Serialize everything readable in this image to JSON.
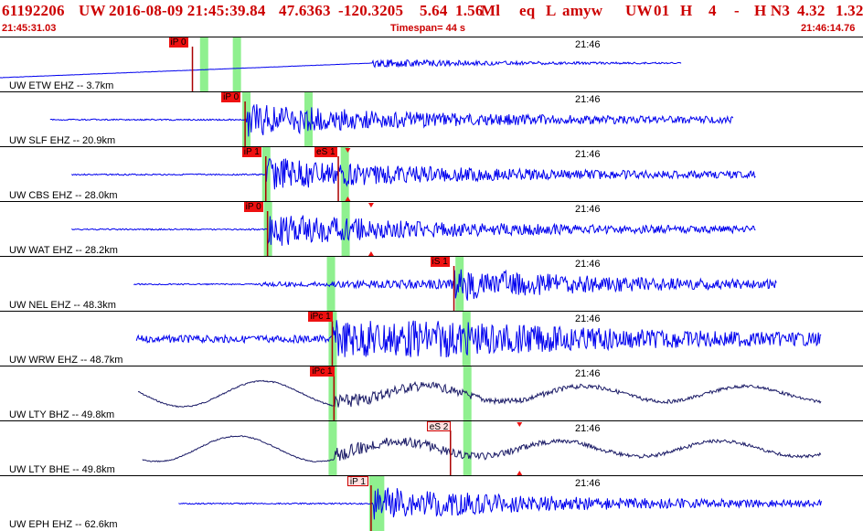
{
  "header": {
    "event_id": "61192206",
    "network": "UW",
    "datetime": "2016-08-09 21:45:39.84",
    "lat": "47.6363",
    "lon": "-120.3205",
    "depth": "5.64",
    "magnitude": "1.56",
    "mag_type": "Ml",
    "event_type": "eq",
    "l_flag": "L",
    "author": "amyw",
    "subnet": "UW",
    "version": "01",
    "h_flag": "H",
    "count": "4",
    "dash": "-",
    "hn": "H N3",
    "r1": "4.32",
    "r2": "1.32",
    "start_time": "21:45:31.03",
    "timespan": "Timespan= 44 s",
    "end_time": "21:46:14.76"
  },
  "time_mark": "21:46",
  "colors": {
    "accent": "#cc0000",
    "trace": "#0000ee",
    "trace_dark": "#1a1a66",
    "phase": "#8ff08f"
  },
  "traces": [
    {
      "label": "UW ETW EHZ -- 3.7km",
      "picks": [
        {
          "text": "iP 0",
          "style": "auto",
          "pos": 0.223
        }
      ],
      "green": [
        0.236,
        0.274
      ],
      "color": "blue",
      "type": "drift",
      "amp": 0.18,
      "start": 0.0,
      "onset": 0.432,
      "end": 0.79,
      "seed": 1
    },
    {
      "label": "UW SLF EHZ -- 20.9km",
      "picks": [
        {
          "text": "iP 0",
          "style": "auto",
          "pos": 0.284
        }
      ],
      "green": [
        0.285,
        0.357
      ],
      "color": "blue",
      "type": "burst",
      "amp": 0.28,
      "start": 0.058,
      "onset": 0.285,
      "end": 0.85,
      "seed": 2
    },
    {
      "label": "UW CBS EHZ -- 28.0km",
      "picks": [
        {
          "text": "iP 1",
          "style": "auto",
          "pos": 0.308
        },
        {
          "text": "eS 1",
          "style": "auto",
          "pos": 0.392
        }
      ],
      "green": [
        0.308,
        0.399
      ],
      "color": "blue",
      "type": "burst",
      "amp": 0.45,
      "start": 0.083,
      "onset": 0.308,
      "end": 0.876,
      "seed": 3,
      "triangle": 0.403
    },
    {
      "label": "UW WAT EHZ -- 28.2km",
      "picks": [
        {
          "text": "iP 0",
          "style": "auto",
          "pos": 0.31
        }
      ],
      "green": [
        0.31,
        0.4
      ],
      "color": "blue",
      "type": "burst",
      "amp": 0.42,
      "start": 0.083,
      "onset": 0.31,
      "end": 0.876,
      "seed": 4,
      "triangle": 0.43
    },
    {
      "label": "UW NEL EHZ -- 48.3km",
      "picks": [
        {
          "text": "iS 1",
          "style": "auto",
          "pos": 0.526
        }
      ],
      "green": [
        0.383,
        0.532
      ],
      "color": "blue",
      "type": "burst",
      "amp": 0.45,
      "start": 0.155,
      "onset": 0.3,
      "end": 0.9,
      "seed": 5,
      "late": 0.526
    },
    {
      "label": "UW WRW EHZ -- 48.7km",
      "picks": [
        {
          "text": "iPc 1",
          "style": "auto",
          "pos": 0.385
        }
      ],
      "green": [
        0.385,
        0.54
      ],
      "color": "blue",
      "type": "noisy",
      "amp": 0.42,
      "start": 0.158,
      "onset": 0.385,
      "end": 0.952,
      "seed": 6
    },
    {
      "label": "UW LTY BHZ -- 49.8km",
      "picks": [
        {
          "text": "iPc 1",
          "style": "auto",
          "pos": 0.387
        }
      ],
      "green": [
        0.385,
        0.541
      ],
      "color": "dark",
      "type": "wave",
      "amp": 0.38,
      "start": 0.16,
      "onset": 0.387,
      "end": 0.952,
      "seed": 7
    },
    {
      "label": "UW LTY BHE -- 49.8km",
      "picks": [
        {
          "text": "eS 2",
          "style": "light",
          "pos": 0.522
        }
      ],
      "green": [
        0.385,
        0.541
      ],
      "color": "dark",
      "type": "wave",
      "amp": 0.4,
      "start": 0.165,
      "onset": 0.387,
      "end": 0.952,
      "seed": 8,
      "triangle": 0.602
    },
    {
      "label": "UW EPH EHZ -- 62.6km",
      "picks": [
        {
          "text": "iP 1",
          "style": "light",
          "pos": 0.43
        }
      ],
      "green": [
        0.432,
        0.44
      ],
      "color": "blue",
      "type": "burst",
      "amp": 0.5,
      "start": 0.207,
      "onset": 0.432,
      "end": 0.952,
      "seed": 9
    }
  ]
}
